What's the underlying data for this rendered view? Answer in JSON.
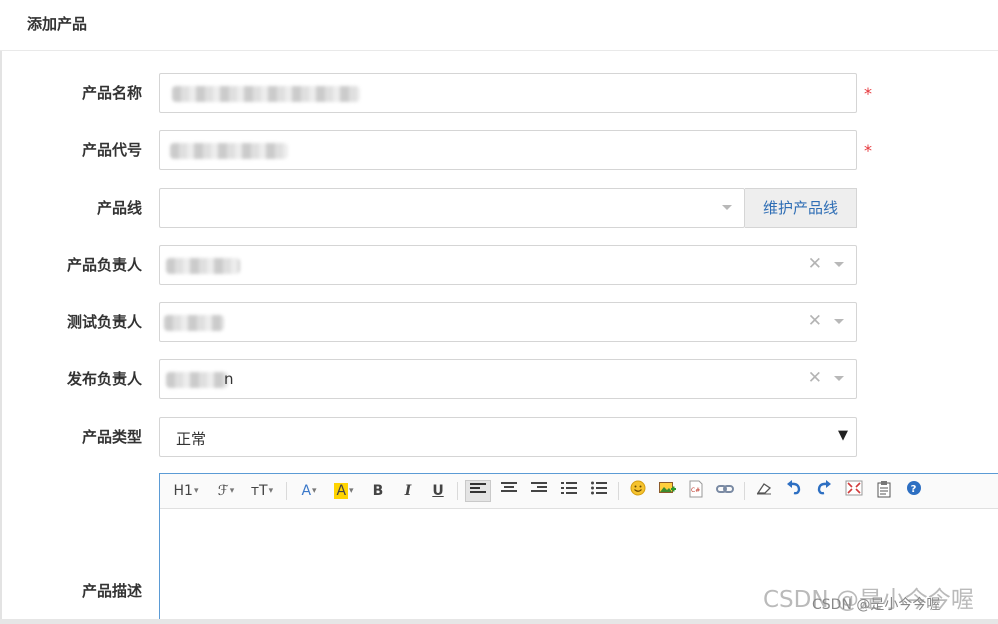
{
  "panel": {
    "title": "添加产品"
  },
  "form": {
    "product_name_label": "产品名称",
    "product_code_label": "产品代号",
    "product_line_label": "产品线",
    "product_line_button": "维护产品线",
    "product_owner_label": "产品负责人",
    "test_owner_label": "测试负责人",
    "release_owner_label": "发布负责人",
    "release_owner_tail": "n",
    "product_type_label": "产品类型",
    "product_type_value": "正常",
    "description_label": "产品描述",
    "required_mark": "*"
  },
  "editor": {
    "tools": [
      "H1",
      "ℱ",
      "тT",
      "A",
      "A",
      "B",
      "I",
      "U"
    ]
  },
  "watermark": {
    "text": "CSDN @是小今今喔",
    "small": "CSDN @是小今今喔"
  },
  "colors": {
    "required": "#e6353a",
    "link": "#2f6eb5",
    "editor_border": "#5b9bd5"
  }
}
